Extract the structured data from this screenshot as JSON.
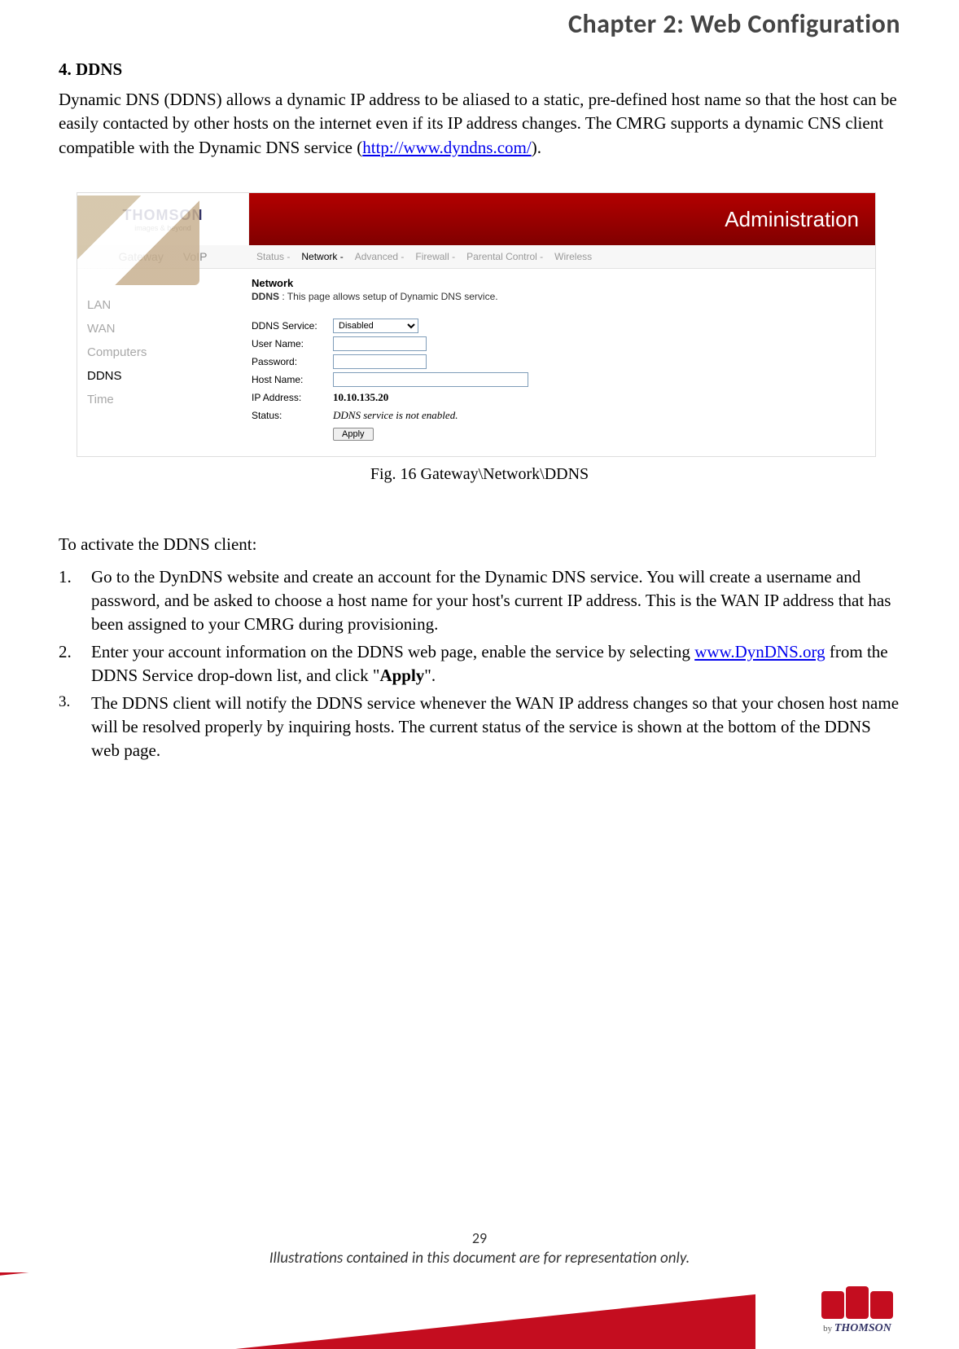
{
  "chapter_title": "Chapter 2: Web Configuration",
  "section": {
    "number_title": "4. DDNS",
    "paragraph_before_link": "Dynamic DNS (DDNS) allows a dynamic IP address to be aliased to a static, pre-defined host name so that the host can be easily contacted by other hosts on the internet even if its IP address changes.    The CMRG supports a dynamic CNS client compatible with the Dynamic DNS service (",
    "link_text": "http://www.dyndns.com/",
    "paragraph_after_link": ")."
  },
  "router_ui": {
    "logo_brand": "THOMSON",
    "logo_tagline": "images & beyond",
    "header_right": "Administration",
    "top_tabs_left": [
      "Gateway",
      "VoIP"
    ],
    "top_tabs_nav": [
      "Status -",
      "Network -",
      "Advanced -",
      "Firewall -",
      "Parental Control -",
      "Wireless"
    ],
    "top_tabs_nav_active_index": 1,
    "sidebar_items": [
      "LAN",
      "WAN",
      "Computers",
      "DDNS",
      "Time"
    ],
    "sidebar_active_index": 3,
    "section_title": "Network",
    "section_desc_label": "DDNS",
    "section_desc_text": ":  This page allows setup of Dynamic DNS service.",
    "form": {
      "ddns_service_label": "DDNS Service:",
      "ddns_service_value": "Disabled",
      "username_label": "User Name:",
      "username_value": "",
      "password_label": "Password:",
      "password_value": "",
      "hostname_label": "Host Name:",
      "hostname_value": "",
      "ip_label": "IP Address:",
      "ip_value": "10.10.135.20",
      "status_label": "Status:",
      "status_value": "DDNS service is not enabled.",
      "apply_label": "Apply"
    }
  },
  "figure_caption": "Fig. 16 Gateway\\Network\\DDNS",
  "activate_intro": "To activate the DDNS client:",
  "steps": [
    {
      "n": "1.",
      "text": "Go to the DynDNS website and create an account for the Dynamic DNS service. You will create a username and password, and be asked to choose a host name for your host's current IP address. This is the WAN IP address that has been assigned to your CMRG during provisioning."
    },
    {
      "n": "2.",
      "pre": "Enter your account information on the DDNS web page, enable the service by selecting ",
      "link": "www.DynDNS.org",
      "mid": " from the DDNS Service drop-down list, and click \"",
      "bold": "Apply",
      "post": "\"."
    },
    {
      "n": "3.",
      "text": "The DDNS client will notify the DDNS service whenever the WAN IP address changes so that your chosen host name will be resolved properly by inquiring hosts. The current status of the service is shown at the bottom of the DDNS web page."
    }
  ],
  "footer": {
    "page_number": "29",
    "note": "Illustrations contained in this document are for representation only.",
    "by": "by",
    "brand": "THOMSON"
  }
}
